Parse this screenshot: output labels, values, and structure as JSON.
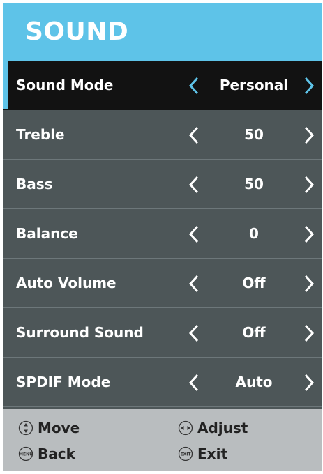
{
  "header": {
    "title": "SOUND"
  },
  "colors": {
    "accent": "#5ec3e8",
    "panel": "#4d5658",
    "selected_row": "#121212",
    "footer": "#b9bdbf"
  },
  "menu": {
    "items": [
      {
        "label": "Sound Mode",
        "value": "Personal",
        "selected": true
      },
      {
        "label": "Treble",
        "value": "50",
        "selected": false
      },
      {
        "label": "Bass",
        "value": "50",
        "selected": false
      },
      {
        "label": "Balance",
        "value": "0",
        "selected": false
      },
      {
        "label": "Auto Volume",
        "value": "Off",
        "selected": false
      },
      {
        "label": "Surround Sound",
        "value": "Off",
        "selected": false
      },
      {
        "label": "SPDIF Mode",
        "value": "Auto",
        "selected": false
      }
    ]
  },
  "footer": {
    "move": {
      "icon": "up-down-icon",
      "label": "Move"
    },
    "adjust": {
      "icon": "left-right-icon",
      "label": "Adjust"
    },
    "back": {
      "icon": "menu-button-icon",
      "icon_text": "MENU",
      "label": "Back"
    },
    "exit": {
      "icon": "exit-button-icon",
      "icon_text": "EXIT",
      "label": "Exit"
    }
  }
}
